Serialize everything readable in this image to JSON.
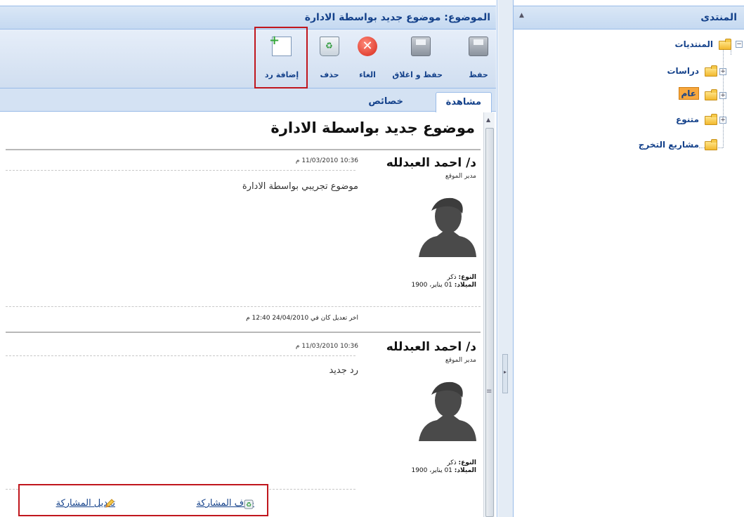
{
  "main": {
    "title": "الموضوع: موضوع جديد بواسطة الادارة",
    "toolbar": {
      "save": "حفظ",
      "save_close": "حفظ و اغلاق",
      "cancel": "الغاء",
      "delete": "حذف",
      "add_reply": "إضافة رد"
    },
    "tabs": {
      "view": "مشاهدة",
      "properties": "خصائص"
    },
    "topic_title": "موضوع جديد بواسطة الادارة",
    "posts": [
      {
        "author": "د/ احمد العبدلله",
        "role": "مدير الموقع",
        "date": "10:36 11/03/2010 م",
        "body": "موضوع تجريبي بواسطة الادارة",
        "gender_label": "النوع:",
        "gender_value": " ذكر",
        "birth_label": "الميلاد:",
        "birth_value": " 01 يناير، 1900",
        "edited": "اخر تعديل كان في 24/04/2010 12:40 م"
      },
      {
        "author": "د/ احمد العبدلله",
        "role": "مدير الموقع",
        "date": "10:36 11/03/2010 م",
        "body": "رد جديد",
        "gender_label": "النوع:",
        "gender_value": " ذكر",
        "birth_label": "الميلاد:",
        "birth_value": " 01 يناير، 1900"
      }
    ],
    "actions": {
      "delete_post": "حذف المشاركة",
      "edit_post": "تعديل المشاركة"
    }
  },
  "side": {
    "title": "المنتدى",
    "tree": {
      "root": "المنتديات",
      "children": [
        "دراسات",
        "عام",
        "متنوع",
        "مشاريع التخرج"
      ]
    }
  },
  "colors": {
    "accent": "#15428b",
    "highlight": "#c0161d",
    "selected_node": "#f7a73d"
  }
}
